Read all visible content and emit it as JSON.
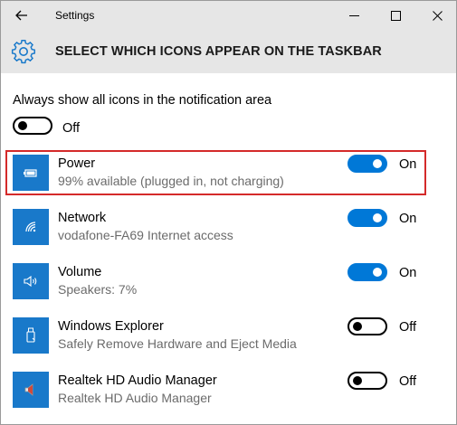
{
  "window": {
    "title": "Settings"
  },
  "header": {
    "title": "SELECT WHICH ICONS APPEAR ON THE TASKBAR"
  },
  "always_show": {
    "label": "Always show all icons in the notification area",
    "state": "Off",
    "on": false
  },
  "items": [
    {
      "name": "Power",
      "description": "99% available (plugged in, not charging)",
      "state": "On",
      "on": true,
      "icon": "battery-icon",
      "highlighted": true
    },
    {
      "name": "Network",
      "description": "vodafone-FA69 Internet access",
      "state": "On",
      "on": true,
      "icon": "wifi-icon"
    },
    {
      "name": "Volume",
      "description": "Speakers: 7%",
      "state": "On",
      "on": true,
      "icon": "speaker-icon"
    },
    {
      "name": "Windows Explorer",
      "description": "Safely Remove Hardware and Eject Media",
      "state": "Off",
      "on": false,
      "icon": "usb-drive-icon"
    },
    {
      "name": "Realtek HD Audio Manager",
      "description": "Realtek HD Audio Manager",
      "state": "Off",
      "on": false,
      "icon": "realtek-speaker-icon"
    }
  ],
  "colors": {
    "accent": "#0078d7",
    "icon_tile": "#1979ca",
    "highlight_border": "#d42a2a",
    "titlebar": "#e6e6e6"
  }
}
